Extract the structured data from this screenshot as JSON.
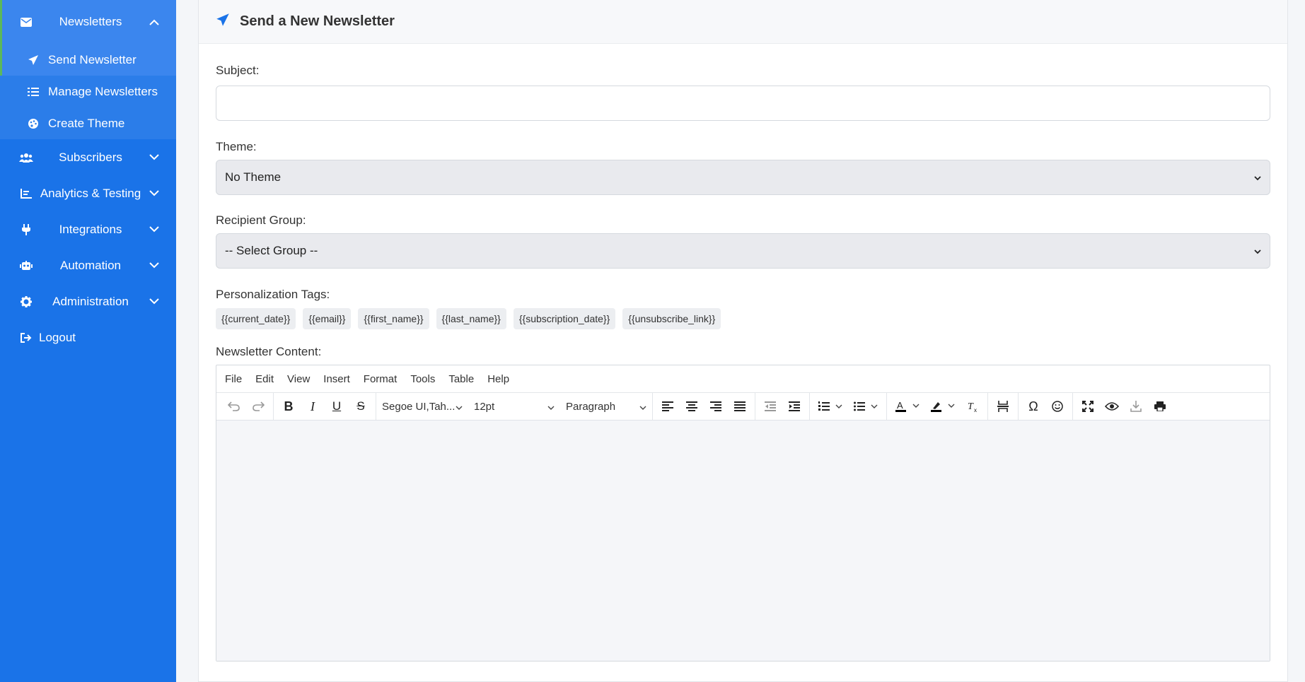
{
  "sidebar": {
    "groups": [
      {
        "label": "Newsletters",
        "icon": "envelope-icon",
        "expanded": true
      },
      {
        "label": "Subscribers",
        "icon": "users-icon"
      },
      {
        "label": "Analytics & Testing",
        "icon": "chart-icon"
      },
      {
        "label": "Integrations",
        "icon": "plug-icon"
      },
      {
        "label": "Automation",
        "icon": "robot-icon"
      },
      {
        "label": "Administration",
        "icon": "gear-icon"
      }
    ],
    "newsletter_items": [
      {
        "label": "Send Newsletter",
        "icon": "paper-plane-icon"
      },
      {
        "label": "Manage Newsletters",
        "icon": "list-icon"
      },
      {
        "label": "Create Theme",
        "icon": "palette-icon"
      }
    ],
    "logout": "Logout"
  },
  "page": {
    "title": "Send a New Newsletter"
  },
  "form": {
    "subject_label": "Subject:",
    "subject_value": "",
    "theme_label": "Theme:",
    "theme_value": "No Theme",
    "group_label": "Recipient Group:",
    "group_value": "-- Select Group --",
    "tags_label": "Personalization Tags:",
    "tags": [
      "{{current_date}}",
      "{{email}}",
      "{{first_name}}",
      "{{last_name}}",
      "{{subscription_date}}",
      "{{unsubscribe_link}}"
    ],
    "content_label": "Newsletter Content:"
  },
  "editor": {
    "menu": [
      "File",
      "Edit",
      "View",
      "Insert",
      "Format",
      "Tools",
      "Table",
      "Help"
    ],
    "font_family": "Segoe UI,Tah...",
    "font_size": "12pt",
    "block_format": "Paragraph"
  },
  "colors": {
    "sidebar": "#1a73e8",
    "active_accent": "#5cb85c",
    "title_icon": "#1a73e8"
  }
}
